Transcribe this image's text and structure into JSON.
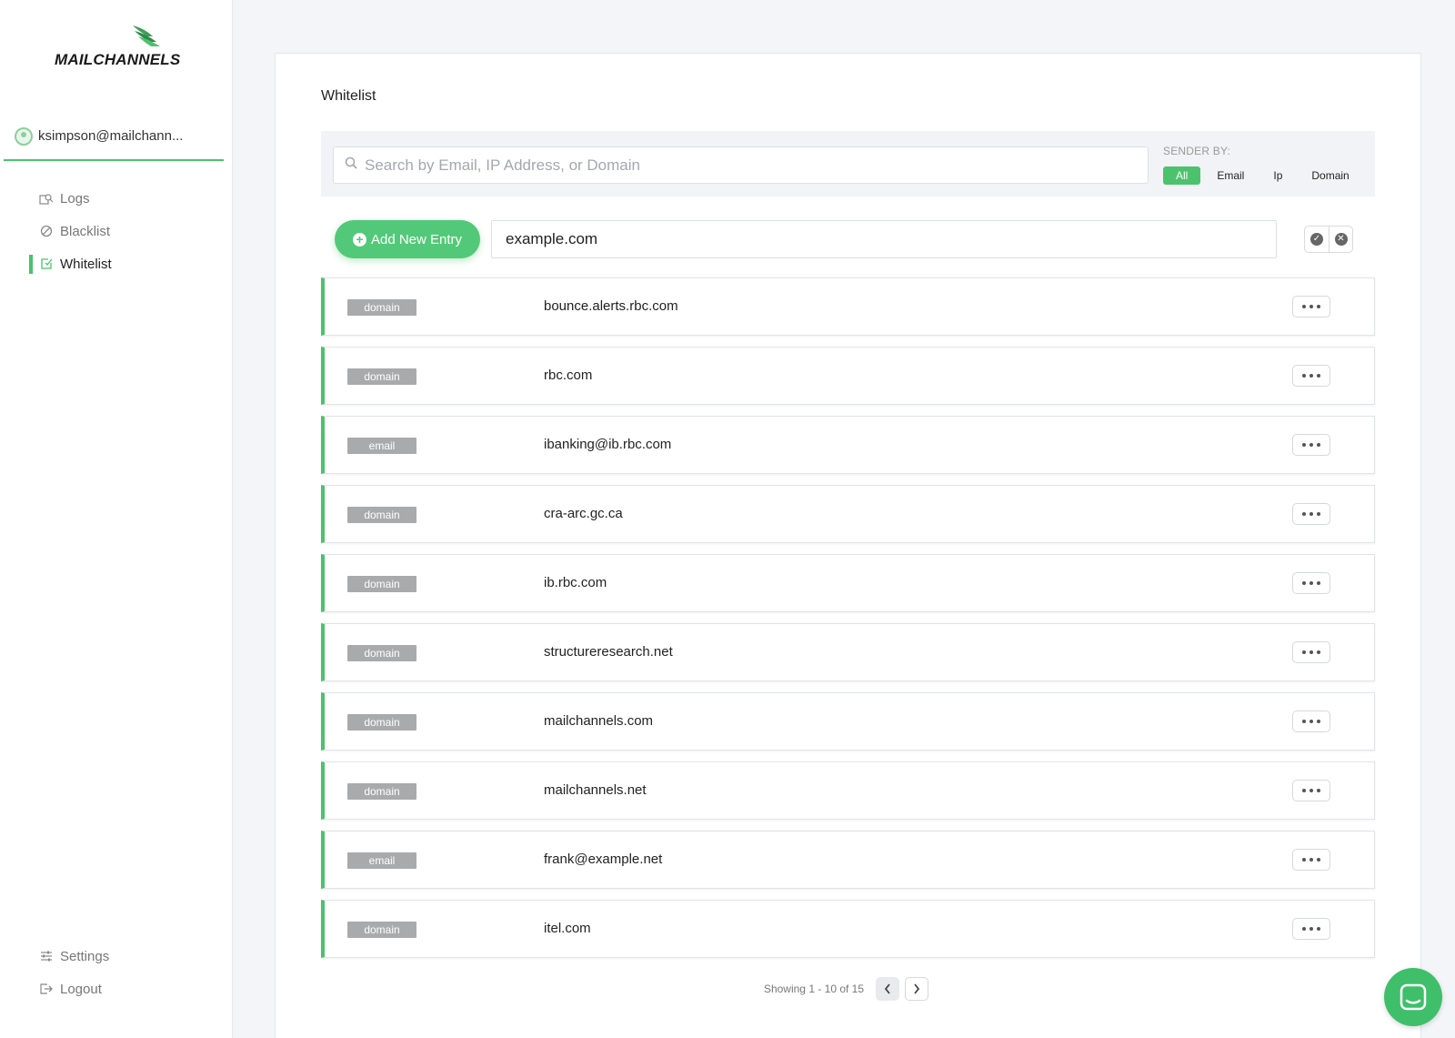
{
  "brand": {
    "name": "MAILCHANNELS",
    "accent": "#4cc26d"
  },
  "user": {
    "email": "ksimpson@mailchann..."
  },
  "sidebar": {
    "items": [
      {
        "label": "Logs",
        "icon": "logs-icon",
        "active": false
      },
      {
        "label": "Blacklist",
        "icon": "blocked-icon",
        "active": false
      },
      {
        "label": "Whitelist",
        "icon": "whitelist-icon",
        "active": true
      }
    ],
    "bottom_items": [
      {
        "label": "Settings",
        "icon": "settings-icon"
      },
      {
        "label": "Logout",
        "icon": "logout-icon"
      }
    ]
  },
  "main": {
    "title": "Whitelist",
    "search": {
      "placeholder": "Search by Email, IP Address, or Domain",
      "value": ""
    },
    "sender_by": {
      "label": "SENDER BY:",
      "options": [
        "All",
        "Email",
        "Ip",
        "Domain"
      ],
      "selected": "All"
    },
    "add_entry": {
      "button_label": "Add New Entry",
      "input_value": "example.com"
    },
    "entries": [
      {
        "type": "domain",
        "value": "bounce.alerts.rbc.com"
      },
      {
        "type": "domain",
        "value": "rbc.com"
      },
      {
        "type": "email",
        "value": "ibanking@ib.rbc.com"
      },
      {
        "type": "domain",
        "value": "cra-arc.gc.ca"
      },
      {
        "type": "domain",
        "value": "ib.rbc.com"
      },
      {
        "type": "domain",
        "value": "structureresearch.net"
      },
      {
        "type": "domain",
        "value": "mailchannels.com"
      },
      {
        "type": "domain",
        "value": "mailchannels.net"
      },
      {
        "type": "email",
        "value": "frank@example.net"
      },
      {
        "type": "domain",
        "value": "itel.com"
      }
    ],
    "pagination": {
      "text": "Showing 1 - 10 of 15"
    }
  }
}
